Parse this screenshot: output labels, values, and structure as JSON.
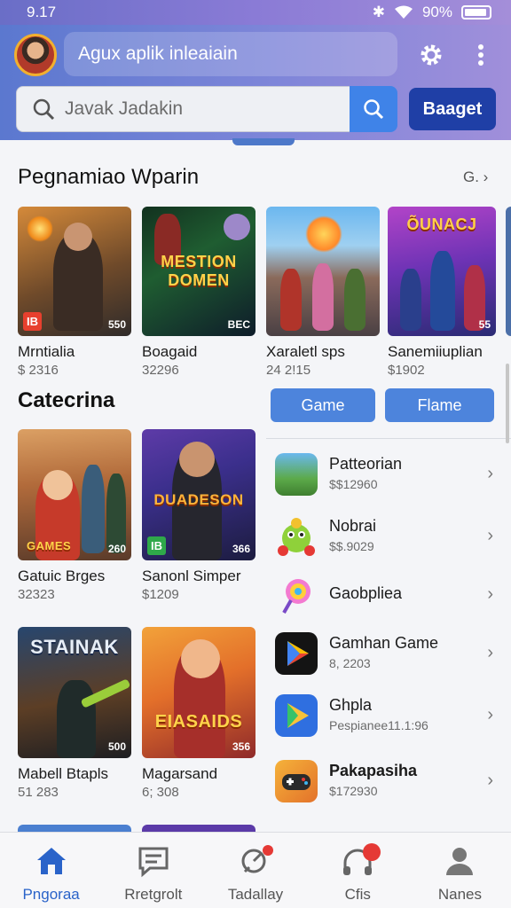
{
  "status": {
    "time": "9.17",
    "battery": "90%"
  },
  "header": {
    "title": "Agux aplik inleaiain",
    "search_placeholder": "Javak Jadakin",
    "primary_button": "Baaget"
  },
  "featured": {
    "title": "Pegnamiao Wparin",
    "see_all": "G.",
    "items": [
      {
        "name": "Mrntialia",
        "price": "$ 2316",
        "art": "",
        "badge": "IB",
        "tag": "550"
      },
      {
        "name": "Boagaid",
        "price": "32296",
        "art": "MESTION DOMEN",
        "badge": "",
        "tag": "BEC"
      },
      {
        "name": "Xaraletl sps",
        "price": "24 2!15",
        "art": "",
        "badge": "",
        "tag": ""
      },
      {
        "name": "Sanemiiuplian",
        "price": "$1902",
        "art": "ÕUNACJ",
        "badge": "",
        "tag": "55"
      }
    ]
  },
  "categories": {
    "title": "Catecrina",
    "chips": [
      "Game",
      "Flame"
    ],
    "grid": [
      {
        "name": "Gatuic Brges",
        "price": "32323",
        "art": "GAMES",
        "badge": "",
        "tag": "260"
      },
      {
        "name": "Sanonl Simper",
        "price": "$1209",
        "art": "DUADESON",
        "badge": "IB",
        "tag": "366"
      },
      {
        "name": "Mabell Btapls",
        "price": "51 283",
        "art": "STAINAK",
        "badge": "",
        "tag": "500"
      },
      {
        "name": "Magarsand",
        "price": "6; 308",
        "art": "EIASAIDS",
        "badge": "",
        "tag": "356"
      }
    ],
    "list": [
      {
        "title": "Patteorian",
        "sub": "$$12960",
        "icon": "game-thumbnail-icon"
      },
      {
        "title": "Nobrai",
        "sub": "$$.9029",
        "icon": "blob-character-icon"
      },
      {
        "title": "Gaobpliea",
        "sub": "",
        "icon": "lollipop-icon"
      },
      {
        "title": "Gamhan Game",
        "sub": "8, 2203",
        "icon": "play-store-icon"
      },
      {
        "title": "Ghpla",
        "sub": "Pespianee11.1:96",
        "icon": "play-triangle-icon"
      },
      {
        "title": "Pakapasiha",
        "sub": "$172930",
        "icon": "gamepad-icon"
      }
    ]
  },
  "nav": [
    {
      "label": "Pngoraa",
      "icon": "home-icon",
      "active": true
    },
    {
      "label": "Rretgrolt",
      "icon": "chat-icon",
      "active": false
    },
    {
      "label": "Tadallay",
      "icon": "search-icon",
      "active": false
    },
    {
      "label": "Cfis",
      "icon": "headphones-icon",
      "active": false
    },
    {
      "label": "Nanes",
      "icon": "profile-icon",
      "active": false
    }
  ],
  "colors": {
    "accent": "#3f83e8",
    "primary": "#1f3fa6",
    "active_nav": "#2a63c9"
  }
}
